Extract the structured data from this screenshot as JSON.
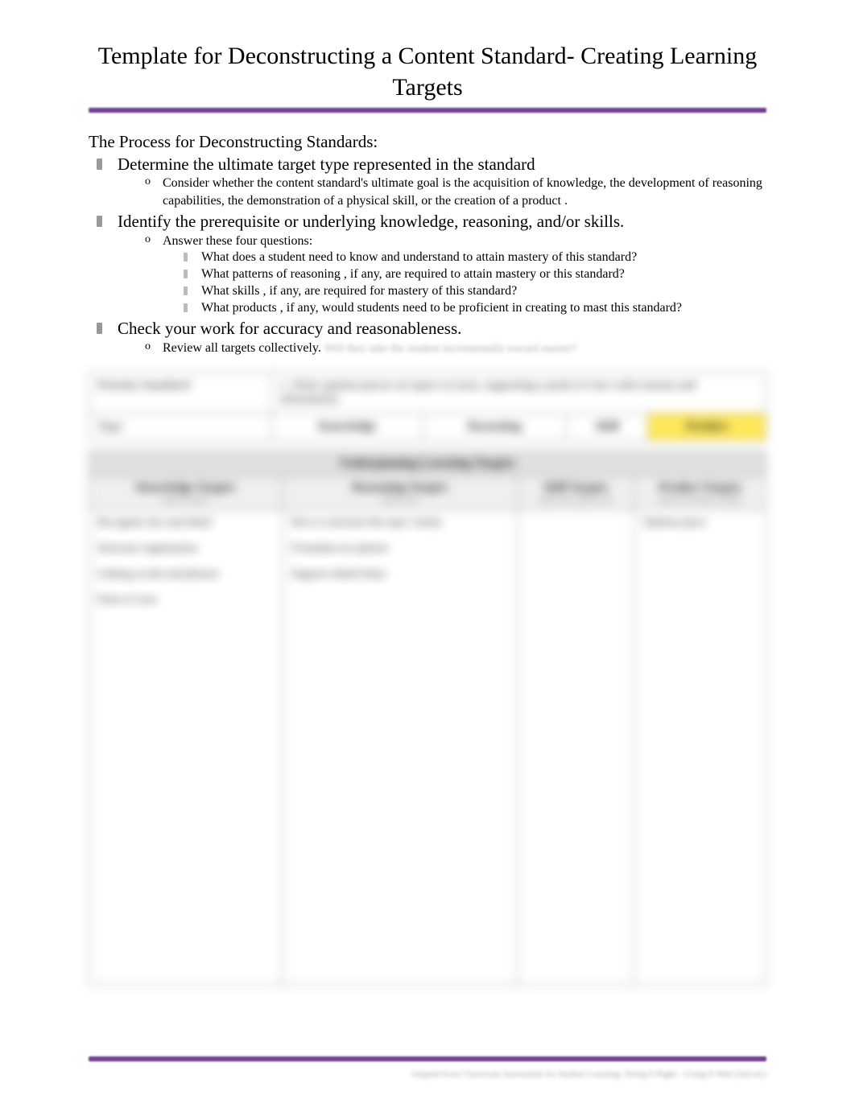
{
  "title": "Template for Deconstructing a Content Standard- Creating Learning Targets",
  "process_heading": "The Process for Deconstructing Standards:",
  "bullets": [
    {
      "text": "Determine the ultimate target type represented in the standard",
      "subs": [
        {
          "text": "Consider whether the content standard's ultimate goal is the acquisition of  knowledge, the development of reasoning  capabilities, the demonstration of a physical  skill, or the creation of a product .",
          "items": []
        }
      ]
    },
    {
      "text": "Identify the prerequisite or underlying knowledge, reasoning, and/or skills.",
      "subs": [
        {
          "text": "Answer these four questions:",
          "items": [
            "What does a student need to know and  understand  to attain mastery of this standard?",
            "What patterns of reasoning , if any, are required to attain mastery or this standard?",
            "What skills , if any, are required for mastery of this standard?",
            "What products , if any, would students need to be proficient in creating to mast this standard?"
          ]
        }
      ]
    },
    {
      "text": "Check your work for accuracy and reasonableness.",
      "subs": [
        {
          "text": "Review all targets collectively.",
          "trailing_note": "Will they take the student incrementally toward master?",
          "items": []
        }
      ]
    }
  ],
  "table1": {
    "row1_label": "Priority Standard",
    "row1_value": "1.  Write opinion pieces on topics or texts, supporting a point of view with reasons and information.",
    "row2_label": "Type",
    "types": [
      "Knowledge",
      "Reasoning",
      "Skill",
      "Product"
    ],
    "highlighted_type_index": 3
  },
  "table2": {
    "section_title": "Underpinning Learning Targets",
    "columns": [
      {
        "head": "Knowledge Targets",
        "sub": "need to know"
      },
      {
        "head": "Reasoning Targets",
        "sub": "need to do"
      },
      {
        "head": "Skill Targets",
        "sub": "need to be able to do"
      },
      {
        "head": "Product Targets",
        "sub": "need to be able to make"
      }
    ],
    "cells": [
      "Recognize fact and detail\n\nStructure organization\n\nLinking words and phrases\n\nPoint of view",
      "How to structure the topic clearly\n\nFormulate an opinion\n\nSupport related ideas",
      "",
      "Opinion piece"
    ]
  },
  "footer": "Adapted from Classroom Assessment for Student Learning: Doing It Right—Using It Well (2nd ed.)"
}
